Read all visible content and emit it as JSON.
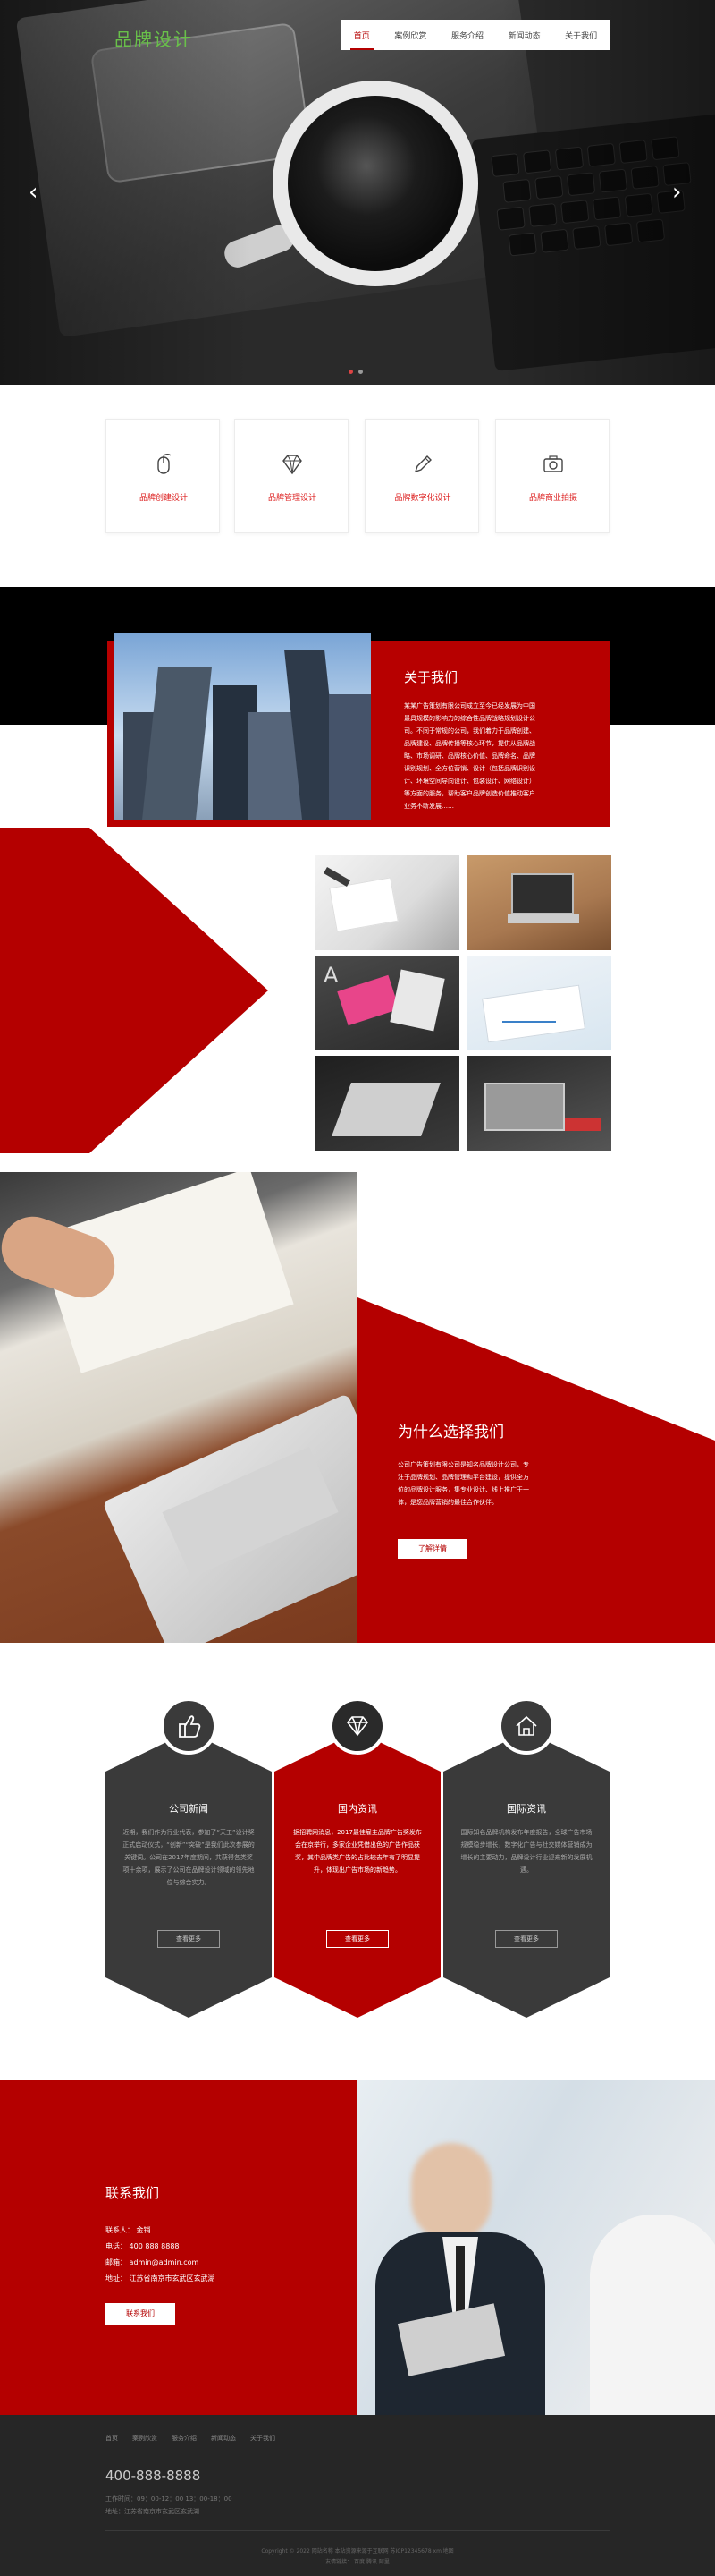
{
  "header": {
    "logo": "品牌设计",
    "nav": [
      "首页",
      "案例欣赏",
      "服务介绍",
      "新闻动态",
      "关于我们"
    ]
  },
  "hero": {
    "prev_icon": "chevron-left-icon",
    "next_icon": "chevron-right-icon",
    "slides": 2,
    "active_slide": 1
  },
  "services": [
    {
      "label": "品牌创建设计",
      "icon": "mouse-icon"
    },
    {
      "label": "品牌管理设计",
      "icon": "diamond-icon"
    },
    {
      "label": "品牌数字化设计",
      "icon": "pencil-icon"
    },
    {
      "label": "品牌商业拍摄",
      "icon": "camera-icon"
    }
  ],
  "about": {
    "title": "关于我们",
    "text": "某某广告策划有限公司成立至今已经发展为中国最具规模的影响力的综合性品牌战略规划设计公司。不同于常规的公司，我们着力于品牌创建、品牌建设、品牌传播等核心环节，提供从品牌战略、市场调研、品牌核心价值、品牌命名、品牌识别规划、全方位营销、设计（包括品牌识别设计、环境空间导向设计、包装设计、网络设计）等方面的服务，帮助客户品牌创造价值推动客户业务不断发展……"
  },
  "why": {
    "title": "为什么选择我们",
    "text": "公司广告策划有限公司是知名品牌设计公司，专注于品牌规划、品牌管理和平台建设，提供全方位的品牌设计服务，集专业设计、线上推广于一体，是您品牌营销的最佳合作伙伴。",
    "button": "了解详情"
  },
  "news": [
    {
      "title": "公司新闻",
      "icon": "thumbs-up-icon",
      "text": "近期，我们作为行业代表，参加了“天工”设计奖正式启动仪式，“创新”“突破”是我们此次参展的关键词。公司在2017年度期间，共获得各类奖项十余项，展示了公司在品牌设计领域的领先地位与综合实力。",
      "more": "查看更多"
    },
    {
      "title": "国内资讯",
      "icon": "diamond-icon",
      "text": "据招聘网消息，2017最佳雇主品牌广告奖发布会在京举行，多家企业凭借出色的广告作品获奖，其中品牌类广告的占比较去年有了明显提升，体现出广告市场的新趋势。",
      "more": "查看更多"
    },
    {
      "title": "国际资讯",
      "icon": "home-icon",
      "text": "国际知名品牌机构发布年度报告，全球广告市场规模稳步增长，数字化广告与社交媒体营销成为增长的主要动力，品牌设计行业迎来新的发展机遇。",
      "more": "查看更多"
    }
  ],
  "contact": {
    "title": "联系我们",
    "lines": [
      "联系人：  金销",
      "电话：  400 888 8888",
      "邮箱：  admin@admin.com",
      "地址：  江苏省南京市玄武区玄武湖"
    ],
    "button": "联系我们"
  },
  "footer": {
    "nav": [
      "首页",
      "案例欣赏",
      "服务介绍",
      "新闻动态",
      "关于我们"
    ],
    "phone": "400-888-8888",
    "hours": "工作时间：09：00-12：00   13：00-18：00",
    "address": "地址：江苏省南京市玄武区玄武湖",
    "copyright": "Copyright © 2022 网站名称 本站资源来源于互联网 苏ICP12345678 xml地图",
    "links": "友情链接：  百度  腾讯  阿里"
  },
  "colors": {
    "brand_red": "#b40000",
    "logo_green": "#69c04a",
    "dark": "#262626"
  }
}
